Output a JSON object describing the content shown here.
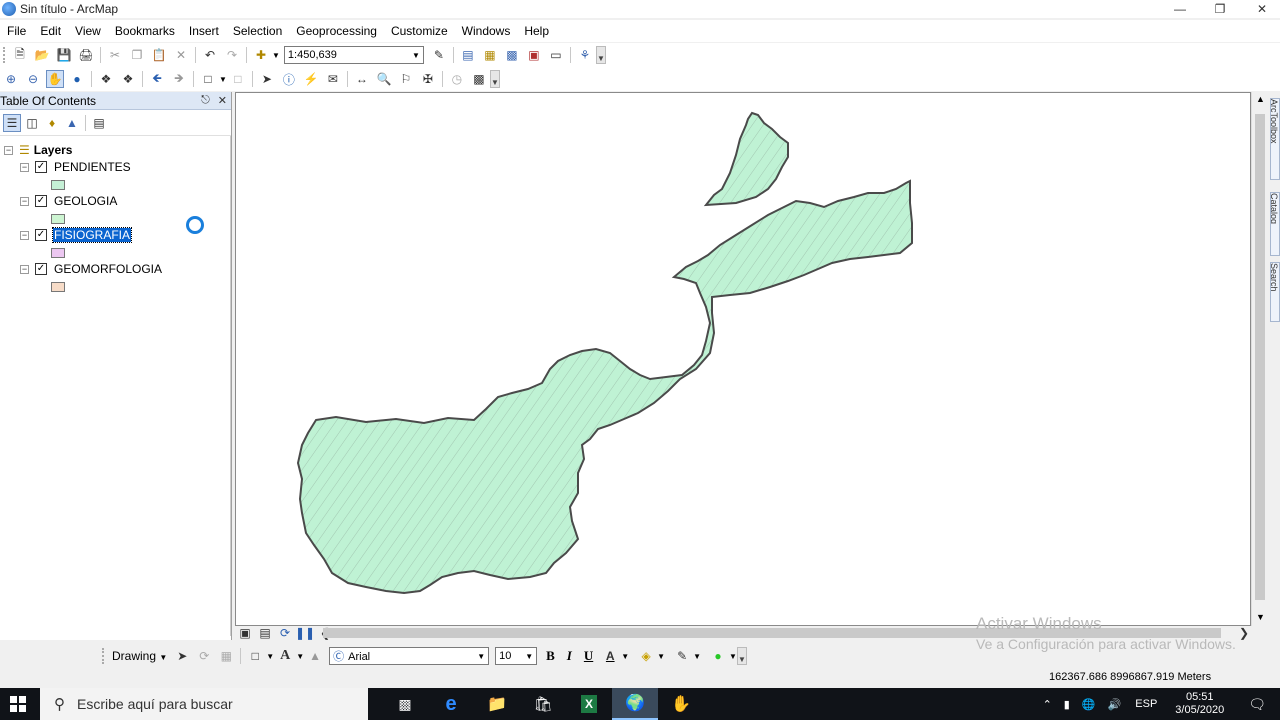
{
  "window": {
    "title": "Sin título - ArcMap"
  },
  "menubar": [
    "File",
    "Edit",
    "View",
    "Bookmarks",
    "Insert",
    "Selection",
    "Geoprocessing",
    "Customize",
    "Windows",
    "Help"
  ],
  "toolbar": {
    "scale": "1:450,639"
  },
  "toc": {
    "title": "Table Of Contents",
    "root": "Layers",
    "layers": [
      {
        "name": "PENDIENTES",
        "checked": true,
        "swatch": "#c5f0d6",
        "selected": false
      },
      {
        "name": "GEOLOGIA",
        "checked": true,
        "swatch": "#cdf5d2",
        "selected": false
      },
      {
        "name": "FISIOGRAFIA",
        "checked": true,
        "swatch": "#ecc7f1",
        "selected": true
      },
      {
        "name": "GEOMORFOLOGIA",
        "checked": true,
        "swatch": "#f7dcc8",
        "selected": false
      }
    ]
  },
  "map": {
    "fill": "#bff2d4",
    "stroke": "#4a4a4a"
  },
  "side_tabs": [
    "ArcToolbox",
    "Catalog",
    "Search"
  ],
  "drawing": {
    "label": "Drawing",
    "font": "Arial",
    "size": "10",
    "bold": "B",
    "italic": "I",
    "underline": "U"
  },
  "status": {
    "coords": "162367.686  8996867.919 Meters"
  },
  "watermark": {
    "line1": "Activar Windows",
    "line2": "Ve a Configuración para activar Windows."
  },
  "taskbar": {
    "search_placeholder": "Escribe aquí para buscar",
    "lang": "ESP",
    "time": "05:51",
    "date": "3/05/2020"
  }
}
